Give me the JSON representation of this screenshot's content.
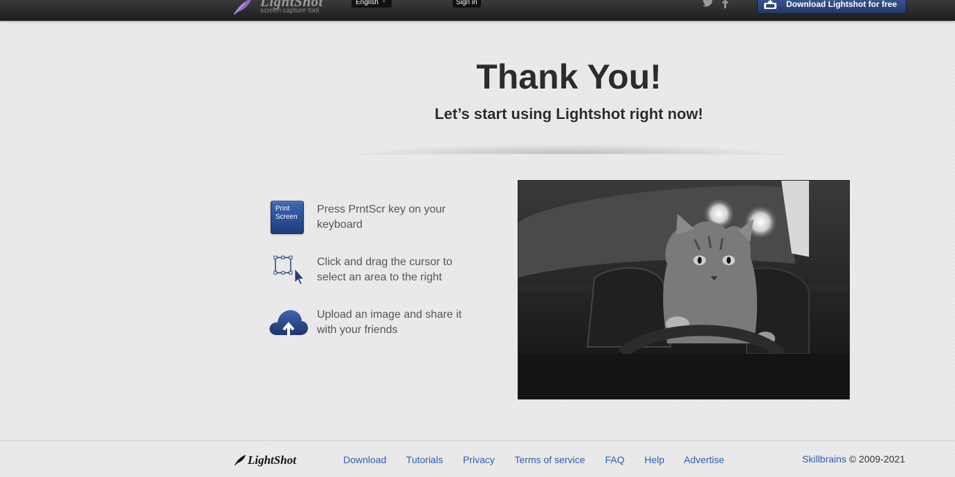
{
  "header": {
    "logo_title": "LightShot",
    "logo_tagline": "screen capture tool",
    "language": "English",
    "signin_label": "Sign in",
    "social": [
      "twitter-icon",
      "facebook-icon"
    ],
    "download_label": "Download Lightshot for free"
  },
  "hero": {
    "title": "Thank You!",
    "subtitle": "Let’s start using Lightshot right now!"
  },
  "steps": [
    {
      "icon": "print-screen-key-icon",
      "key_line1": "Print",
      "key_line2": "Screen",
      "text": "Press PrntScr key on your keyboard"
    },
    {
      "icon": "selection-cursor-icon",
      "text": "Click and drag the cursor to select an area to the right"
    },
    {
      "icon": "cloud-upload-icon",
      "text": "Upload an image and share it with your friends"
    }
  ],
  "footer": {
    "logo": "LightShot",
    "links": [
      "Download",
      "Tutorials",
      "Privacy",
      "Terms of service",
      "FAQ",
      "Help",
      "Advertise"
    ],
    "company": "Skillbrains",
    "copyright": "© 2009-2021"
  },
  "colors": {
    "accent_blue": "#23396b",
    "link_blue": "#2a5db0",
    "background": "#e9e9e9",
    "topbar": "#262626"
  }
}
